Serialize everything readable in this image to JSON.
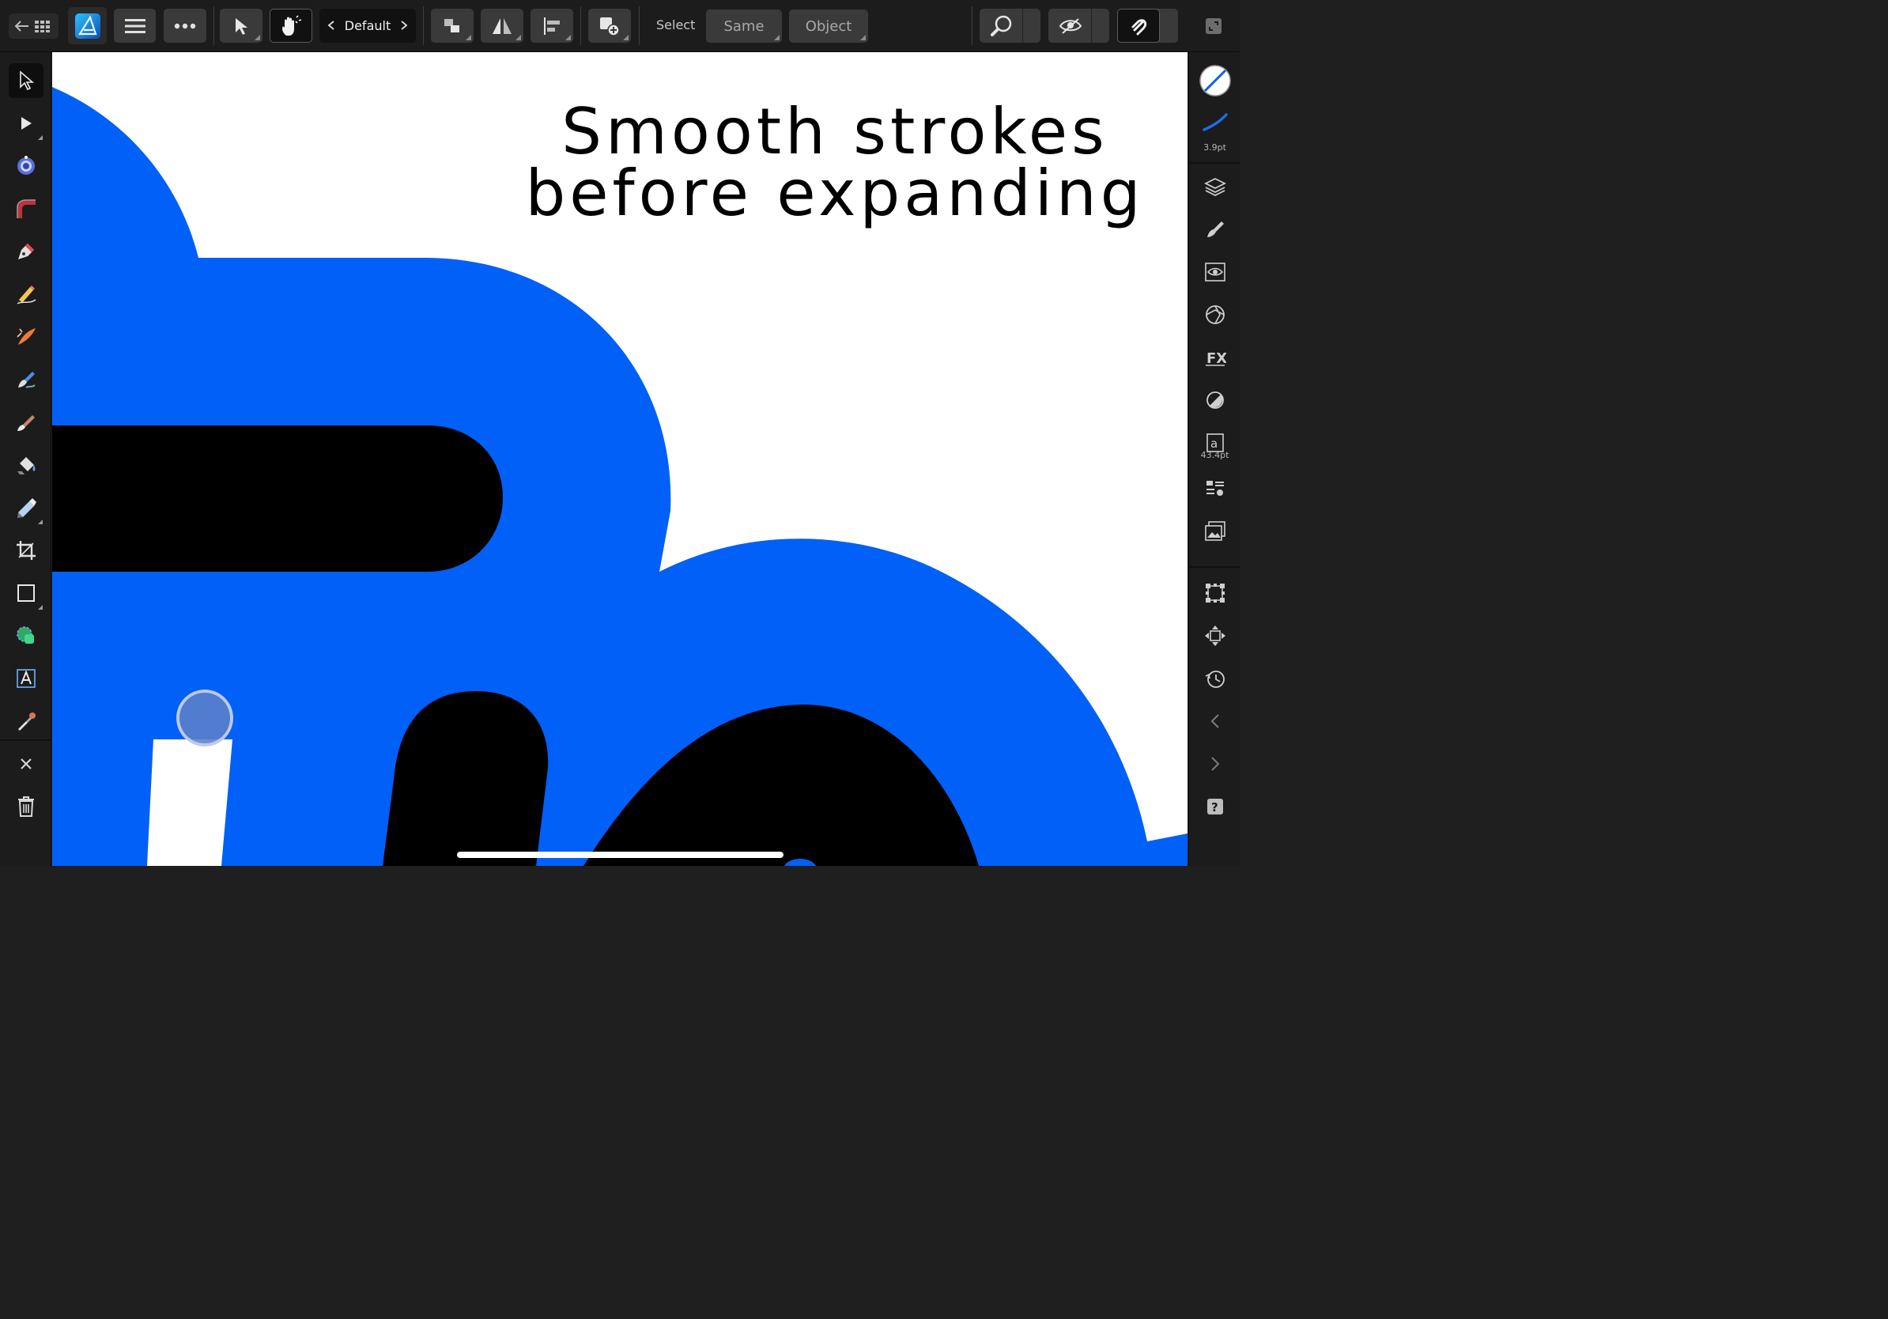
{
  "toolbar": {
    "style_preset": "Default",
    "select_label": "Select",
    "same_label": "Same",
    "object_label": "Object"
  },
  "canvas": {
    "headline_line1": "Smooth strokes",
    "headline_line2": "before expanding",
    "colors": {
      "blue": "#0060F8",
      "black": "#000000",
      "white": "#FFFFFF"
    }
  },
  "right_panel": {
    "stroke_width": "3.9pt",
    "text_size": "43.4pt"
  },
  "icons": {
    "top": [
      "back-grid-icon",
      "app-logo-icon",
      "hamburger-menu-icon",
      "more-icon",
      "move-tool-icon",
      "gesture-icon",
      "chevron-left-icon",
      "chevron-right-icon",
      "arrange-icon",
      "flip-icon",
      "align-icon",
      "insert-icon",
      "zoom-icon",
      "view-mode-icon",
      "snapping-icon",
      "fullscreen-icon"
    ],
    "left": [
      "move-tool-icon",
      "node-tool-icon",
      "corner-tool-icon",
      "curve-tool-icon",
      "pen-tool-icon",
      "pencil-tool-icon",
      "vector-brush-icon",
      "paint-brush-icon",
      "erase-brush-icon",
      "fill-tool-icon",
      "transparency-tool-icon",
      "crop-tool-icon",
      "rectangle-tool-icon",
      "shape-builder-icon",
      "text-tool-icon",
      "color-picker-icon",
      "close-icon",
      "trash-icon"
    ],
    "right": [
      "color-icon",
      "stroke-icon",
      "layers-icon",
      "brushes-icon",
      "appearance-icon",
      "symbols-icon",
      "fx-icon",
      "transparency-icon",
      "text-style-icon",
      "styles-icon",
      "stock-icon",
      "transform-icon",
      "navigator-icon",
      "history-icon",
      "chevron-left-icon",
      "chevron-right-icon",
      "help-icon"
    ]
  }
}
